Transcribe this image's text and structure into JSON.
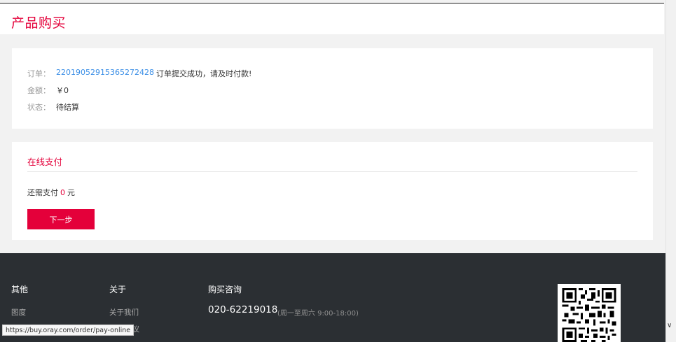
{
  "header": {
    "title": "产品购买"
  },
  "order": {
    "order_label": "订单：",
    "order_number": "22019052915365272428",
    "order_message": "订单提交成功，请及时付款!",
    "amount_label": "金额：",
    "amount_value": "￥0",
    "status_label": "状态：",
    "status_value": "待结算"
  },
  "payment": {
    "title": "在线支付",
    "remaining_prefix": "还需支付",
    "remaining_amount": "0",
    "remaining_unit": "元",
    "next_label": "下一步"
  },
  "footer": {
    "col_other": {
      "title": "其他",
      "links": [
        "图度"
      ]
    },
    "col_about": {
      "title": "关于",
      "links": [
        "关于我们",
        "协议"
      ]
    },
    "col_consult": {
      "title": "购买咨询",
      "phone": "020-62219018",
      "hours": "(周一至周六 9:00-18:00)"
    }
  },
  "statusbar": {
    "url": "https://buy.oray.com/order/pay-online"
  },
  "colors": {
    "accent": "#e4003a",
    "link": "#3a8ee6",
    "footer_bg": "#2b2f33"
  },
  "icons": {
    "scroll_down": "chevron-down-icon",
    "qr": "qr-code-icon"
  }
}
